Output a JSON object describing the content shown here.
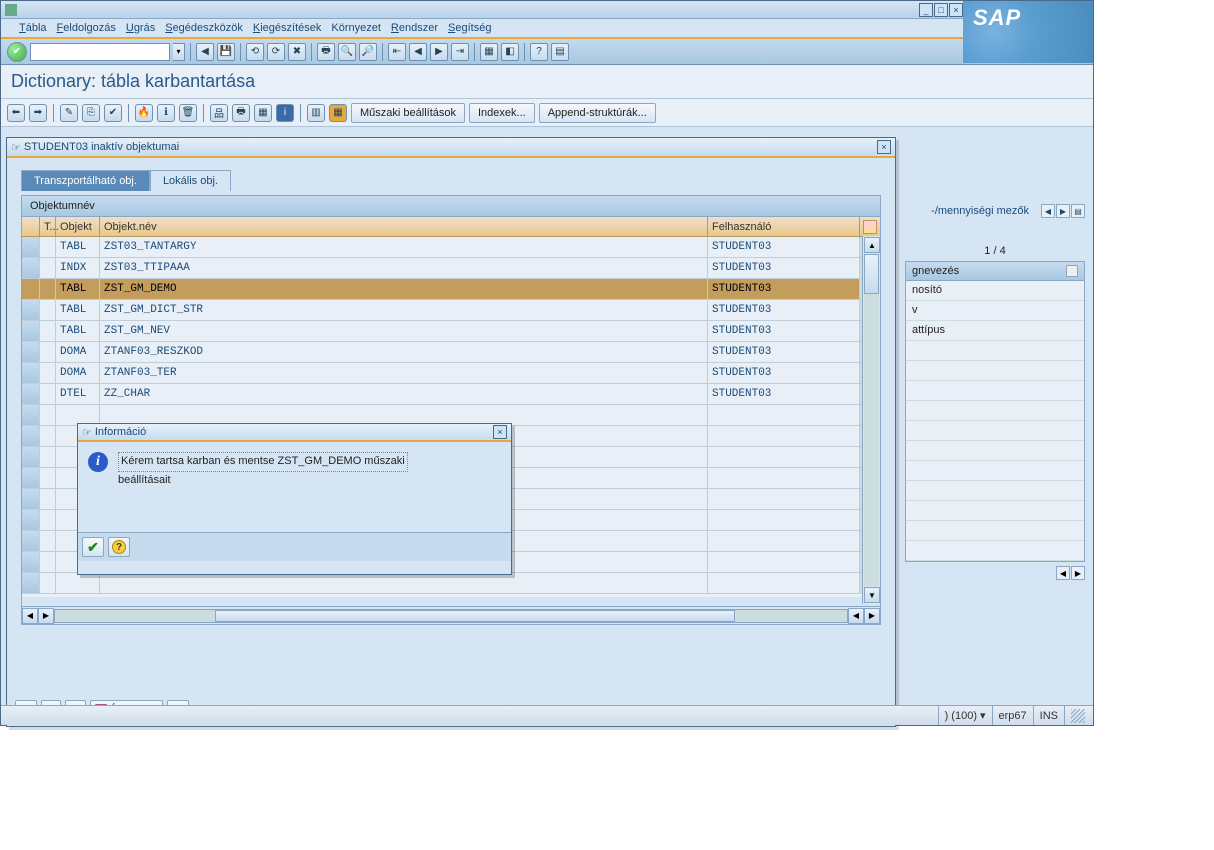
{
  "window": {
    "minimize": "_",
    "maximize": "□",
    "close": "×"
  },
  "sap_logo": "SAP",
  "menu": {
    "tabla": "Tábla",
    "feldolgozas": "Feldolgozás",
    "ugras": "Ugrás",
    "segedeszkozok": "Segédeszközök",
    "kiegeszitesek": "Kiegészítések",
    "kornyezet": "Környezet",
    "rendszer": "Rendszer",
    "segitseg": "Segítség"
  },
  "command_field": "",
  "page_title": "Dictionary: tábla karbantartása",
  "toolbar2": {
    "muszaki": "Műszaki beállítások",
    "indexek": "Indexek...",
    "append": "Append-struktúrák..."
  },
  "bg": {
    "tab": "-/mennyiségi mezők",
    "counter": "1  /  4",
    "header": "gnevezés",
    "rows": [
      "nosító",
      "v",
      "attípus",
      "",
      "",
      "",
      "",
      "",
      "",
      "",
      "",
      "",
      "",
      ""
    ]
  },
  "dialog": {
    "title": "STUDENT03 inaktív objektumai",
    "tab_transport": "Transzportálható obj.",
    "tab_local": "Lokális obj.",
    "caption": "Objektumnév",
    "col_t": "T...",
    "col_obj": "Objekt",
    "col_name": "Objekt.név",
    "col_user": "Felhasználó",
    "rows": [
      {
        "t": "",
        "obj": "TABL",
        "name": "ZST03_TANTARGY",
        "user": "STUDENT03",
        "sel": false
      },
      {
        "t": "",
        "obj": "INDX",
        "name": "ZST03_TTIPAAA",
        "user": "STUDENT03",
        "sel": false
      },
      {
        "t": "",
        "obj": "TABL",
        "name": "ZST_GM_DEMO",
        "user": "STUDENT03",
        "sel": true
      },
      {
        "t": "",
        "obj": "TABL",
        "name": "ZST_GM_DICT_STR",
        "user": "STUDENT03",
        "sel": false
      },
      {
        "t": "",
        "obj": "TABL",
        "name": "ZST_GM_NEV",
        "user": "STUDENT03",
        "sel": false
      },
      {
        "t": "",
        "obj": "DOMA",
        "name": "ZTANF03_RESZKOD",
        "user": "STUDENT03",
        "sel": false
      },
      {
        "t": "",
        "obj": "DOMA",
        "name": "ZTANF03_TER",
        "user": "STUDENT03",
        "sel": false
      },
      {
        "t": "",
        "obj": "DTEL",
        "name": "ZZ_CHAR",
        "user": "STUDENT03",
        "sel": false
      }
    ],
    "overview": "Áttekintés"
  },
  "info": {
    "title": "Információ",
    "line1": "Kérem tartsa karban és mentse ZST_GM_DEMO műszaki",
    "line2": "beállításait"
  },
  "status": {
    "session": ") (100)",
    "server": "erp67",
    "mode": "INS"
  }
}
